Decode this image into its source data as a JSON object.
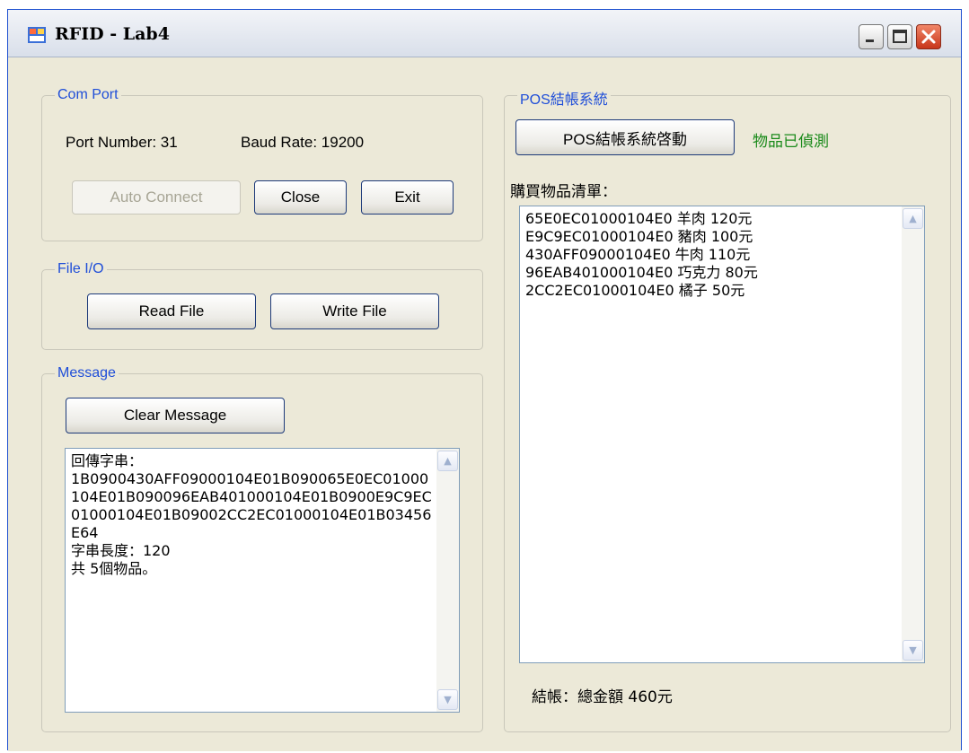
{
  "window": {
    "title": "RFID - Lab4"
  },
  "comport": {
    "legend": "Com Port",
    "port_label": "Port Number: 31",
    "baud_label": "Baud Rate: 19200",
    "auto_connect": "Auto Connect",
    "close": "Close",
    "exit": "Exit"
  },
  "fileio": {
    "legend": "File I/O",
    "read": "Read File",
    "write": "Write File"
  },
  "message": {
    "legend": "Message",
    "clear": "Clear Message",
    "lines": [
      "回傳字串：",
      "1B0900430AFF09000104E01B090065E0EC01000104E01B090096EAB401000104E01B0900E9C9EC01000104E01B09002CC2EC01000104E01B03456E64",
      "字串長度：120",
      "共 5個物品。"
    ]
  },
  "pos": {
    "legend": "POS結帳系統",
    "start_button": "POS結帳系統啓動",
    "status": "物品已偵測",
    "status_color": "#1a8a1a",
    "list_label": "購買物品清單：",
    "items": [
      "65E0EC01000104E0 羊肉 120元",
      "E9C9EC01000104E0 豬肉 100元",
      "430AFF09000104E0 牛肉 110元",
      "96EAB401000104E0 巧克力 80元",
      "2CC2EC01000104E0 橘子 50元"
    ],
    "total": "結帳：總金額 460元"
  }
}
